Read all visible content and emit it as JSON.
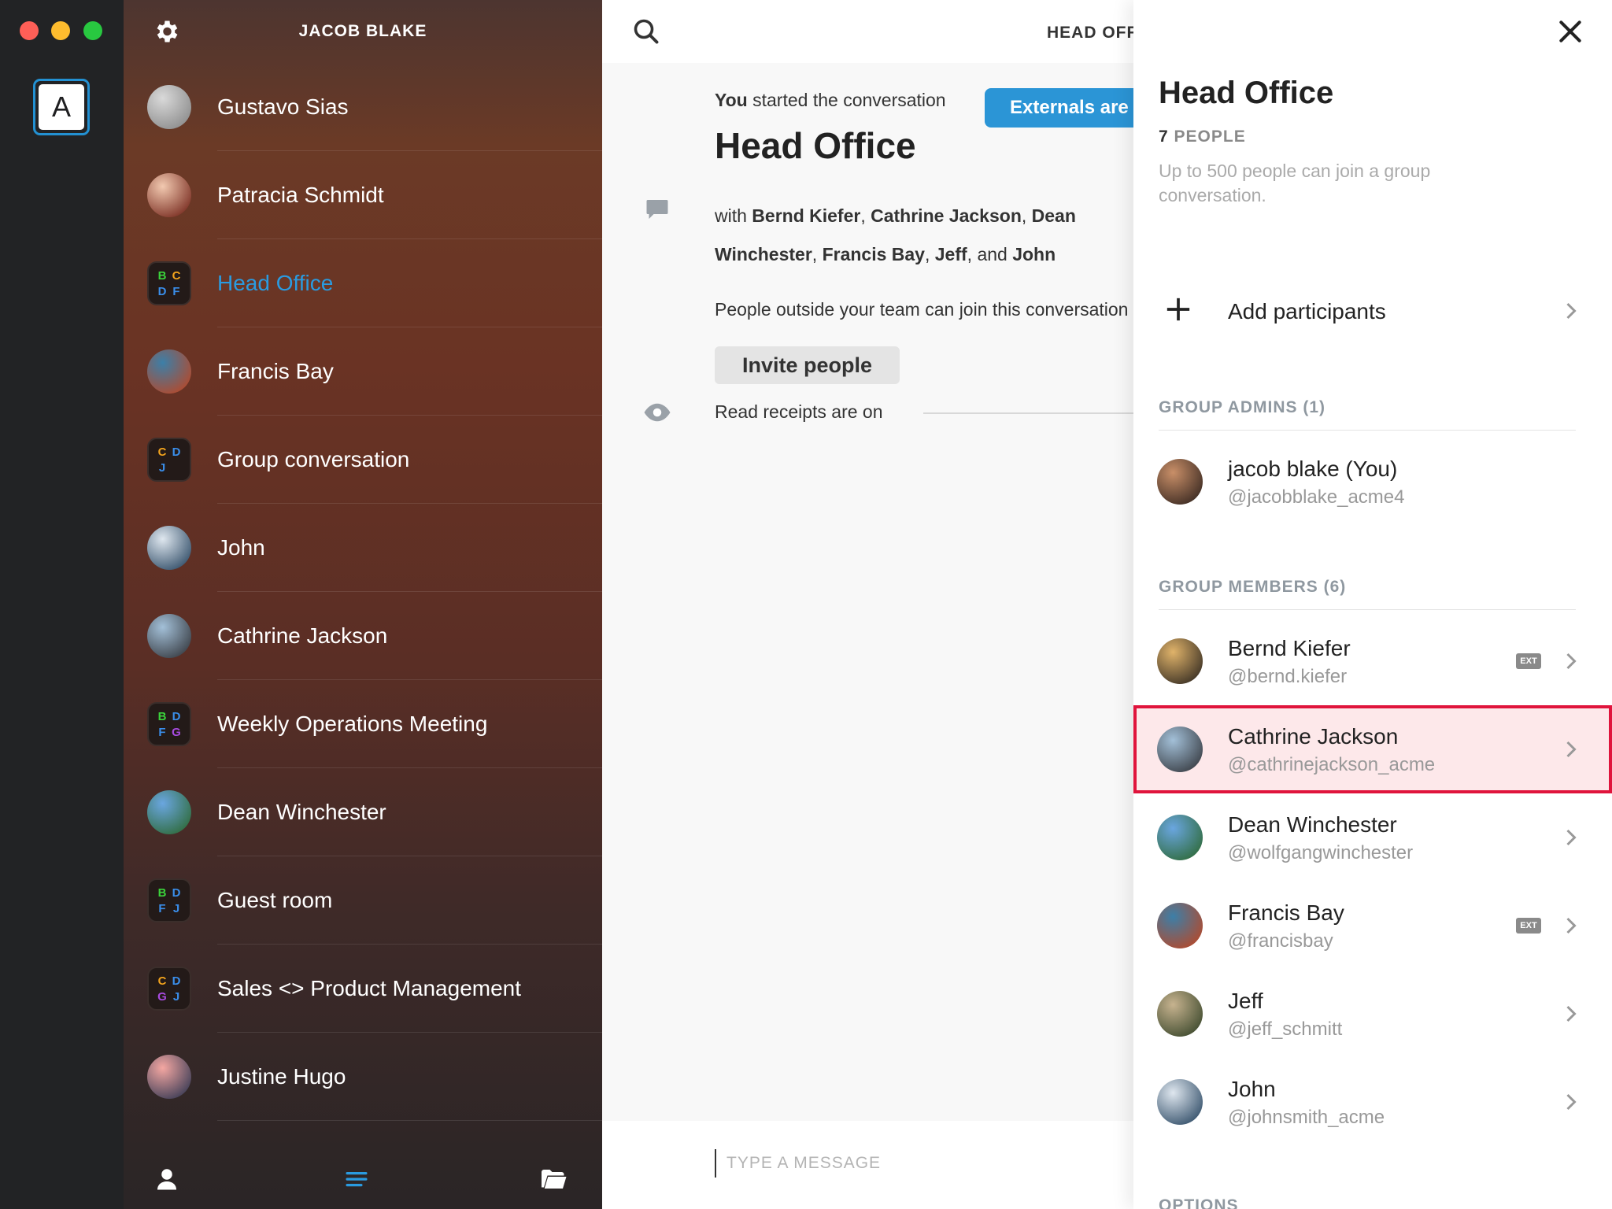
{
  "rail": {
    "account_letter": "A"
  },
  "list": {
    "user": "JACOB BLAKE",
    "items": [
      {
        "name": "Gustavo Sias",
        "kind": "avatar",
        "colors": [
          "#d9d9d9",
          "#8c8c8c"
        ]
      },
      {
        "name": "Patracia Schmidt",
        "kind": "avatar",
        "colors": [
          "#f2c9b0",
          "#7a2e22"
        ]
      },
      {
        "name": "Head Office",
        "kind": "group",
        "active": true,
        "letters": [
          "B",
          "C",
          "D",
          "F"
        ]
      },
      {
        "name": "Francis Bay",
        "kind": "avatar",
        "colors": [
          "#3c7fa8",
          "#b4492b"
        ]
      },
      {
        "name": "Group conversation",
        "kind": "group",
        "letters": [
          "C",
          "D",
          "J",
          ""
        ]
      },
      {
        "name": "John",
        "kind": "avatar",
        "colors": [
          "#dfe7ef",
          "#34506a"
        ]
      },
      {
        "name": "Cathrine Jackson",
        "kind": "avatar",
        "colors": [
          "#a3c0d8",
          "#3a3f46"
        ]
      },
      {
        "name": "Weekly Operations Meeting",
        "kind": "group",
        "letters": [
          "B",
          "D",
          "F",
          "G"
        ]
      },
      {
        "name": "Dean Winchester",
        "kind": "avatar",
        "colors": [
          "#6aa6e0",
          "#2f6b3c"
        ]
      },
      {
        "name": "Guest room",
        "kind": "group",
        "letters": [
          "B",
          "D",
          "F",
          "J"
        ]
      },
      {
        "name": "Sales <> Product Management",
        "kind": "group",
        "letters": [
          "C",
          "D",
          "G",
          "J"
        ]
      },
      {
        "name": "Justine Hugo",
        "kind": "avatar",
        "colors": [
          "#f4a7a2",
          "#3b3c55"
        ]
      }
    ],
    "letter_colors": {
      "B": "#3bd23b",
      "C": "#f2a31d",
      "D": "#3a8eea",
      "F": "#3a8eea",
      "G": "#a84be0",
      "J": "#3a8eea"
    }
  },
  "main": {
    "header_title": "HEAD OFFICE",
    "started_bold": "You",
    "started_rest": " started the conversation",
    "externals_badge": "Externals are here",
    "title": "Head Office",
    "with_prefix": "with ",
    "with_names": [
      "Bernd Kiefer",
      "Cathrine Jackson",
      "Dean Winchester",
      "Francis Bay",
      "Jeff"
    ],
    "with_and": "and",
    "with_last": "John",
    "people_outside": "People outside your team can join this conversation",
    "invite_button": "Invite people",
    "read_receipts": "Read receipts are on",
    "composer_placeholder": "TYPE A MESSAGE"
  },
  "details": {
    "title": "Head Office",
    "count_number": "7",
    "count_label": " PEOPLE",
    "description": "Up to 500 people can join a group conversation.",
    "add_participants": "Add participants",
    "admins_label": "GROUP ADMINS (1)",
    "members_label": "GROUP MEMBERS (6)",
    "options_label": "OPTIONS",
    "admin": {
      "name": "jacob blake (You)",
      "handle": "@jacobblake_acme4",
      "colors": [
        "#c98f68",
        "#3b2a22"
      ]
    },
    "members": [
      {
        "name": "Bernd Kiefer",
        "handle": "@bernd.kiefer",
        "ext": "EXT",
        "colors": [
          "#e0b36a",
          "#3a3024"
        ]
      },
      {
        "name": "Cathrine Jackson",
        "handle": "@cathrinejackson_acme",
        "selected": true,
        "colors": [
          "#a3c0d8",
          "#3a3f46"
        ]
      },
      {
        "name": "Dean Winchester",
        "handle": "@wolfgangwinchester",
        "colors": [
          "#6aa6e0",
          "#2f6b3c"
        ]
      },
      {
        "name": "Francis Bay",
        "handle": "@francisbay",
        "ext": "EXT",
        "colors": [
          "#3c7fa8",
          "#b4492b"
        ]
      },
      {
        "name": "Jeff",
        "handle": "@jeff_schmitt",
        "colors": [
          "#c7b38f",
          "#3e4a2e"
        ]
      },
      {
        "name": "John",
        "handle": "@johnsmith_acme",
        "colors": [
          "#dfe7ef",
          "#34506a"
        ]
      }
    ]
  },
  "colors": {
    "accent": "#2a9be0",
    "selected_outline": "#e0143c",
    "selected_bg": "#fde8ea"
  }
}
